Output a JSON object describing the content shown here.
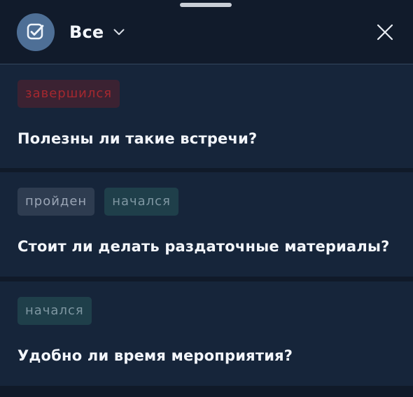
{
  "header": {
    "avatar_icon": "check-square-icon",
    "filter_label": "Все",
    "filter_icon": "chevron-down-icon",
    "close_icon": "close-icon"
  },
  "items": [
    {
      "badges": [
        {
          "label": "завершился",
          "status": "ended",
          "color": "#a5282f"
        }
      ],
      "question": "Полезны ли такие встречи?"
    },
    {
      "badges": [
        {
          "label": "пройден",
          "status": "passed",
          "color": "#9aa5b5"
        },
        {
          "label": "начался",
          "status": "started",
          "color": "#7f97a2"
        }
      ],
      "question": "Стоит ли делать раздаточные материалы?"
    },
    {
      "badges": [
        {
          "label": "начался",
          "status": "started",
          "color": "#7f97a2"
        }
      ],
      "question": "Удобно ли время мероприятия?"
    }
  ],
  "colors": {
    "background": "#101a29",
    "card": "#16253a",
    "avatar": "#4e6f96",
    "text": "#f3f6fb"
  }
}
